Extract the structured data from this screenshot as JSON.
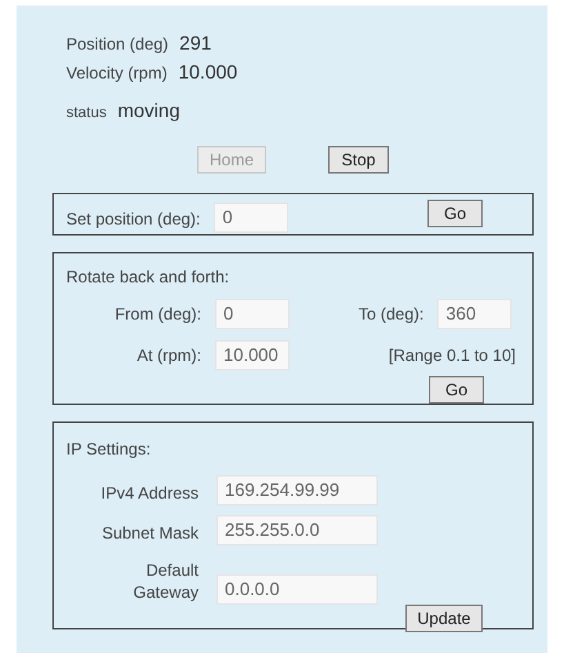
{
  "readouts": [
    {
      "label": "Position (deg)",
      "value": "291"
    },
    {
      "label": "Velocity (rpm)",
      "value": "10.000"
    },
    {
      "label": "status",
      "value": "moving"
    }
  ],
  "controls": [
    {
      "label": "Home",
      "disabled": true
    },
    {
      "label": "Stop",
      "disabled": false
    }
  ],
  "set_position": {
    "label": "Set position (deg):",
    "value": "0",
    "button": {
      "label": "Go",
      "disabled": false
    }
  },
  "rotate": {
    "title": "Rotate back and forth:",
    "from_label": "From (deg):",
    "from_value": "0",
    "to_label": "To (deg):",
    "to_value": "360",
    "at_label": "At (rpm):",
    "at_value": "10.000",
    "range_note": "[Range 0.1 to 10]",
    "button": {
      "label": "Go",
      "disabled": false
    }
  },
  "ip_settings": {
    "title": "IP Settings:",
    "fields": [
      {
        "label": "IPv4 Address",
        "value": "169.254.99.99"
      },
      {
        "label": "Subnet Mask",
        "value": "255.255.0.0"
      },
      {
        "label": "Default Gateway",
        "value": "0.0.0.0"
      }
    ],
    "button": {
      "label": "Update",
      "disabled": false
    }
  }
}
